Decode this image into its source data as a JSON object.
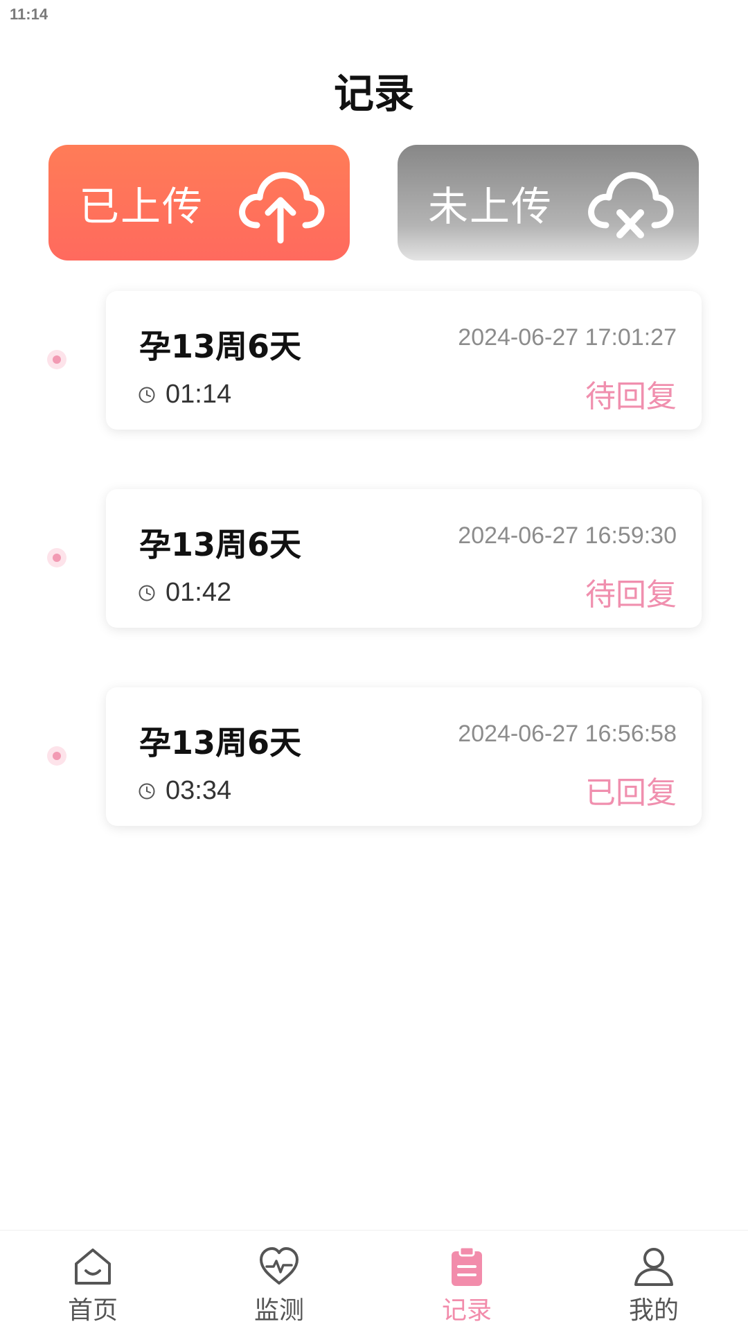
{
  "status_bar": {
    "time": "11:14"
  },
  "header": {
    "title": "记录"
  },
  "upload_tabs": {
    "uploaded_label": "已上传",
    "not_uploaded_label": "未上传",
    "uploaded_color": "#ff6f5a",
    "not_uploaded_color": "#9a9a9a"
  },
  "records": [
    {
      "week": "孕13周6天",
      "datetime": "2024-06-27 17:01:27",
      "duration": "01:14",
      "status": "待回复"
    },
    {
      "week": "孕13周6天",
      "datetime": "2024-06-27 16:59:30",
      "duration": "01:42",
      "status": "待回复"
    },
    {
      "week": "孕13周6天",
      "datetime": "2024-06-27 16:56:58",
      "duration": "03:34",
      "status": "已回复"
    }
  ],
  "bottom_nav": {
    "items": [
      {
        "label": "首页",
        "icon": "home-icon"
      },
      {
        "label": "监测",
        "icon": "heart-monitor-icon"
      },
      {
        "label": "记录",
        "icon": "clipboard-icon"
      },
      {
        "label": "我的",
        "icon": "user-icon"
      }
    ],
    "active_index": 2,
    "accent_color": "#f28cab"
  }
}
